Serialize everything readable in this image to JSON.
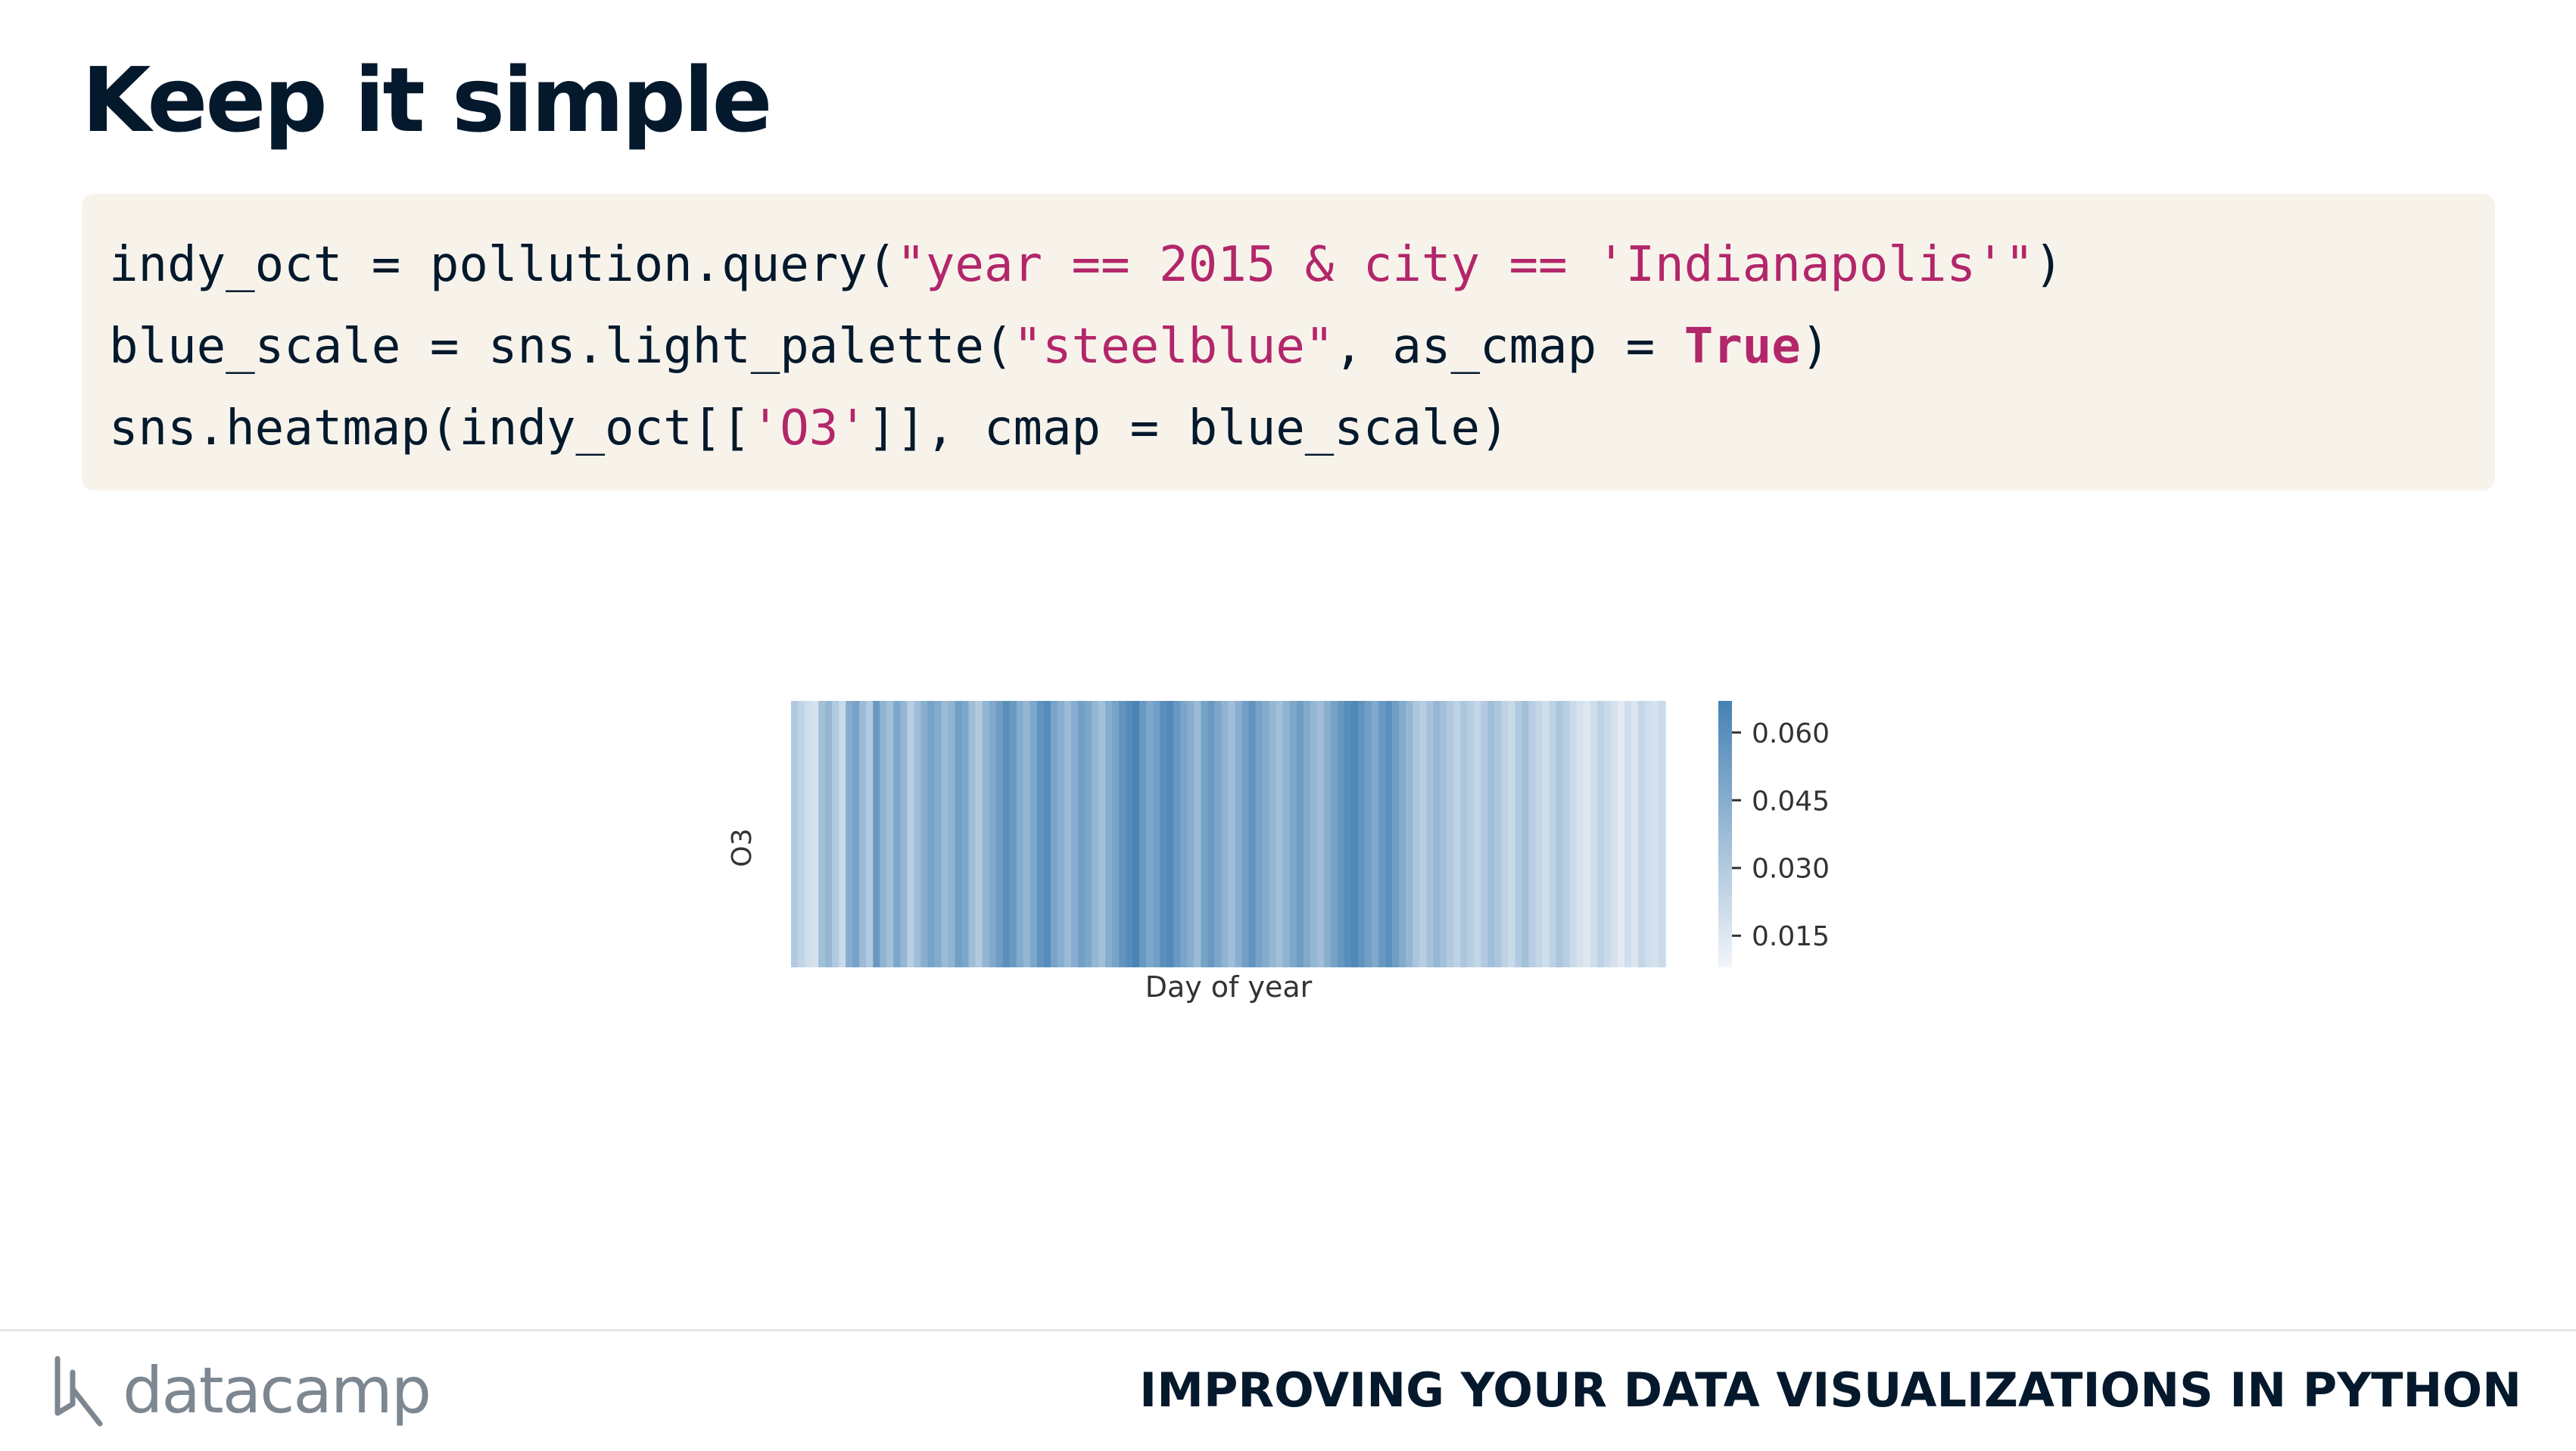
{
  "slide": {
    "title": "Keep it simple",
    "course_title": "IMPROVING YOUR DATA VISUALIZATIONS IN PYTHON",
    "logo_text": "datacamp"
  },
  "code": {
    "line1": {
      "a": "indy_oct = pollution.query(",
      "s": "\"year == 2015 & city == 'Indianapolis'\"",
      "b": ")"
    },
    "line2": {
      "a": "blue_scale = sns.light_palette(",
      "s": "\"steelblue\"",
      "b": ", as_cmap = ",
      "k": "True",
      "c": ")"
    },
    "line3": {
      "a": "sns.heatmap(indy_oct[[",
      "s": "'O3'",
      "b": "]], cmap = blue_scale)"
    }
  },
  "colors": {
    "accent": "#b3266a",
    "code_bg": "#f7f3eb",
    "text": "#05192d",
    "heat_low": "#f2f5f9",
    "heat_high": "#4682b4"
  },
  "chart_data": {
    "type": "heatmap",
    "xlabel": "Day of year",
    "ylabel": "O3",
    "colorbar": {
      "ticks": [
        "0.060",
        "0.045",
        "0.030",
        "0.015"
      ],
      "tick_values": [
        0.06,
        0.045,
        0.03,
        0.015
      ],
      "range": [
        0.008,
        0.067
      ]
    },
    "values": [
      0.03,
      0.025,
      0.02,
      0.018,
      0.035,
      0.04,
      0.03,
      0.022,
      0.045,
      0.05,
      0.038,
      0.03,
      0.055,
      0.042,
      0.035,
      0.048,
      0.04,
      0.028,
      0.036,
      0.044,
      0.05,
      0.046,
      0.038,
      0.042,
      0.052,
      0.048,
      0.036,
      0.03,
      0.041,
      0.047,
      0.053,
      0.06,
      0.055,
      0.046,
      0.04,
      0.048,
      0.058,
      0.062,
      0.05,
      0.044,
      0.038,
      0.045,
      0.052,
      0.048,
      0.04,
      0.035,
      0.045,
      0.05,
      0.058,
      0.062,
      0.066,
      0.055,
      0.048,
      0.052,
      0.06,
      0.063,
      0.055,
      0.049,
      0.044,
      0.038,
      0.05,
      0.055,
      0.048,
      0.042,
      0.036,
      0.044,
      0.052,
      0.058,
      0.05,
      0.046,
      0.04,
      0.035,
      0.042,
      0.048,
      0.053,
      0.047,
      0.04,
      0.036,
      0.044,
      0.05,
      0.056,
      0.061,
      0.064,
      0.058,
      0.052,
      0.047,
      0.055,
      0.06,
      0.053,
      0.046,
      0.04,
      0.032,
      0.028,
      0.034,
      0.04,
      0.035,
      0.03,
      0.026,
      0.032,
      0.028,
      0.024,
      0.03,
      0.036,
      0.032,
      0.026,
      0.022,
      0.03,
      0.035,
      0.028,
      0.024,
      0.02,
      0.026,
      0.032,
      0.028,
      0.022,
      0.018,
      0.015,
      0.02,
      0.026,
      0.022,
      0.018,
      0.014,
      0.02,
      0.016,
      0.024,
      0.02,
      0.018,
      0.022
    ]
  }
}
